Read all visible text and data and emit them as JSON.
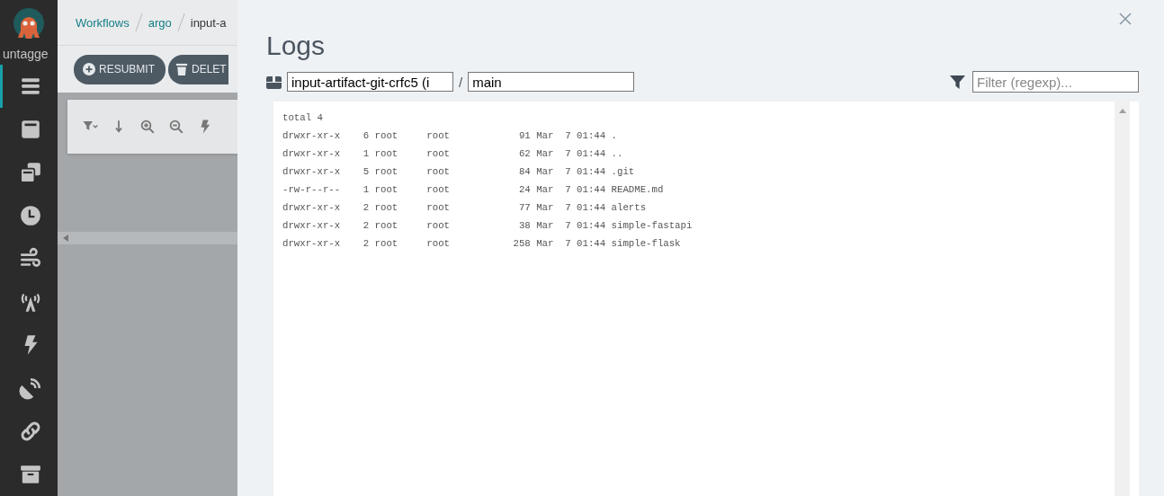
{
  "sidebar": {
    "user": "untagge",
    "items": [
      {
        "selected": true
      },
      {
        "selected": false
      },
      {
        "selected": false
      },
      {
        "selected": false
      },
      {
        "selected": false
      },
      {
        "selected": false
      },
      {
        "selected": false
      },
      {
        "selected": false
      },
      {
        "selected": false
      },
      {
        "selected": false
      }
    ]
  },
  "breadcrumbs": [
    "Workflows",
    "argo",
    "input-a"
  ],
  "actions": [
    {
      "label": "RESUBMIT"
    },
    {
      "label": "DELET"
    }
  ],
  "logs": {
    "title": "Logs",
    "pod": "input-artifact-git-crfc5 (i",
    "separator": "/",
    "container": "main",
    "filter": {
      "placeholder": "Filter (regexp)..."
    },
    "lines": [
      "total 4",
      "drwxr-xr-x    6 root     root            91 Mar  7 01:44 .",
      "drwxr-xr-x    1 root     root            62 Mar  7 01:44 ..",
      "drwxr-xr-x    5 root     root            84 Mar  7 01:44 .git",
      "-rw-r--r--    1 root     root            24 Mar  7 01:44 README.md",
      "drwxr-xr-x    2 root     root            77 Mar  7 01:44 alerts",
      "drwxr-xr-x    2 root     root            38 Mar  7 01:44 simple-fastapi",
      "drwxr-xr-x    2 root     root           258 Mar  7 01:44 simple-flask"
    ]
  }
}
